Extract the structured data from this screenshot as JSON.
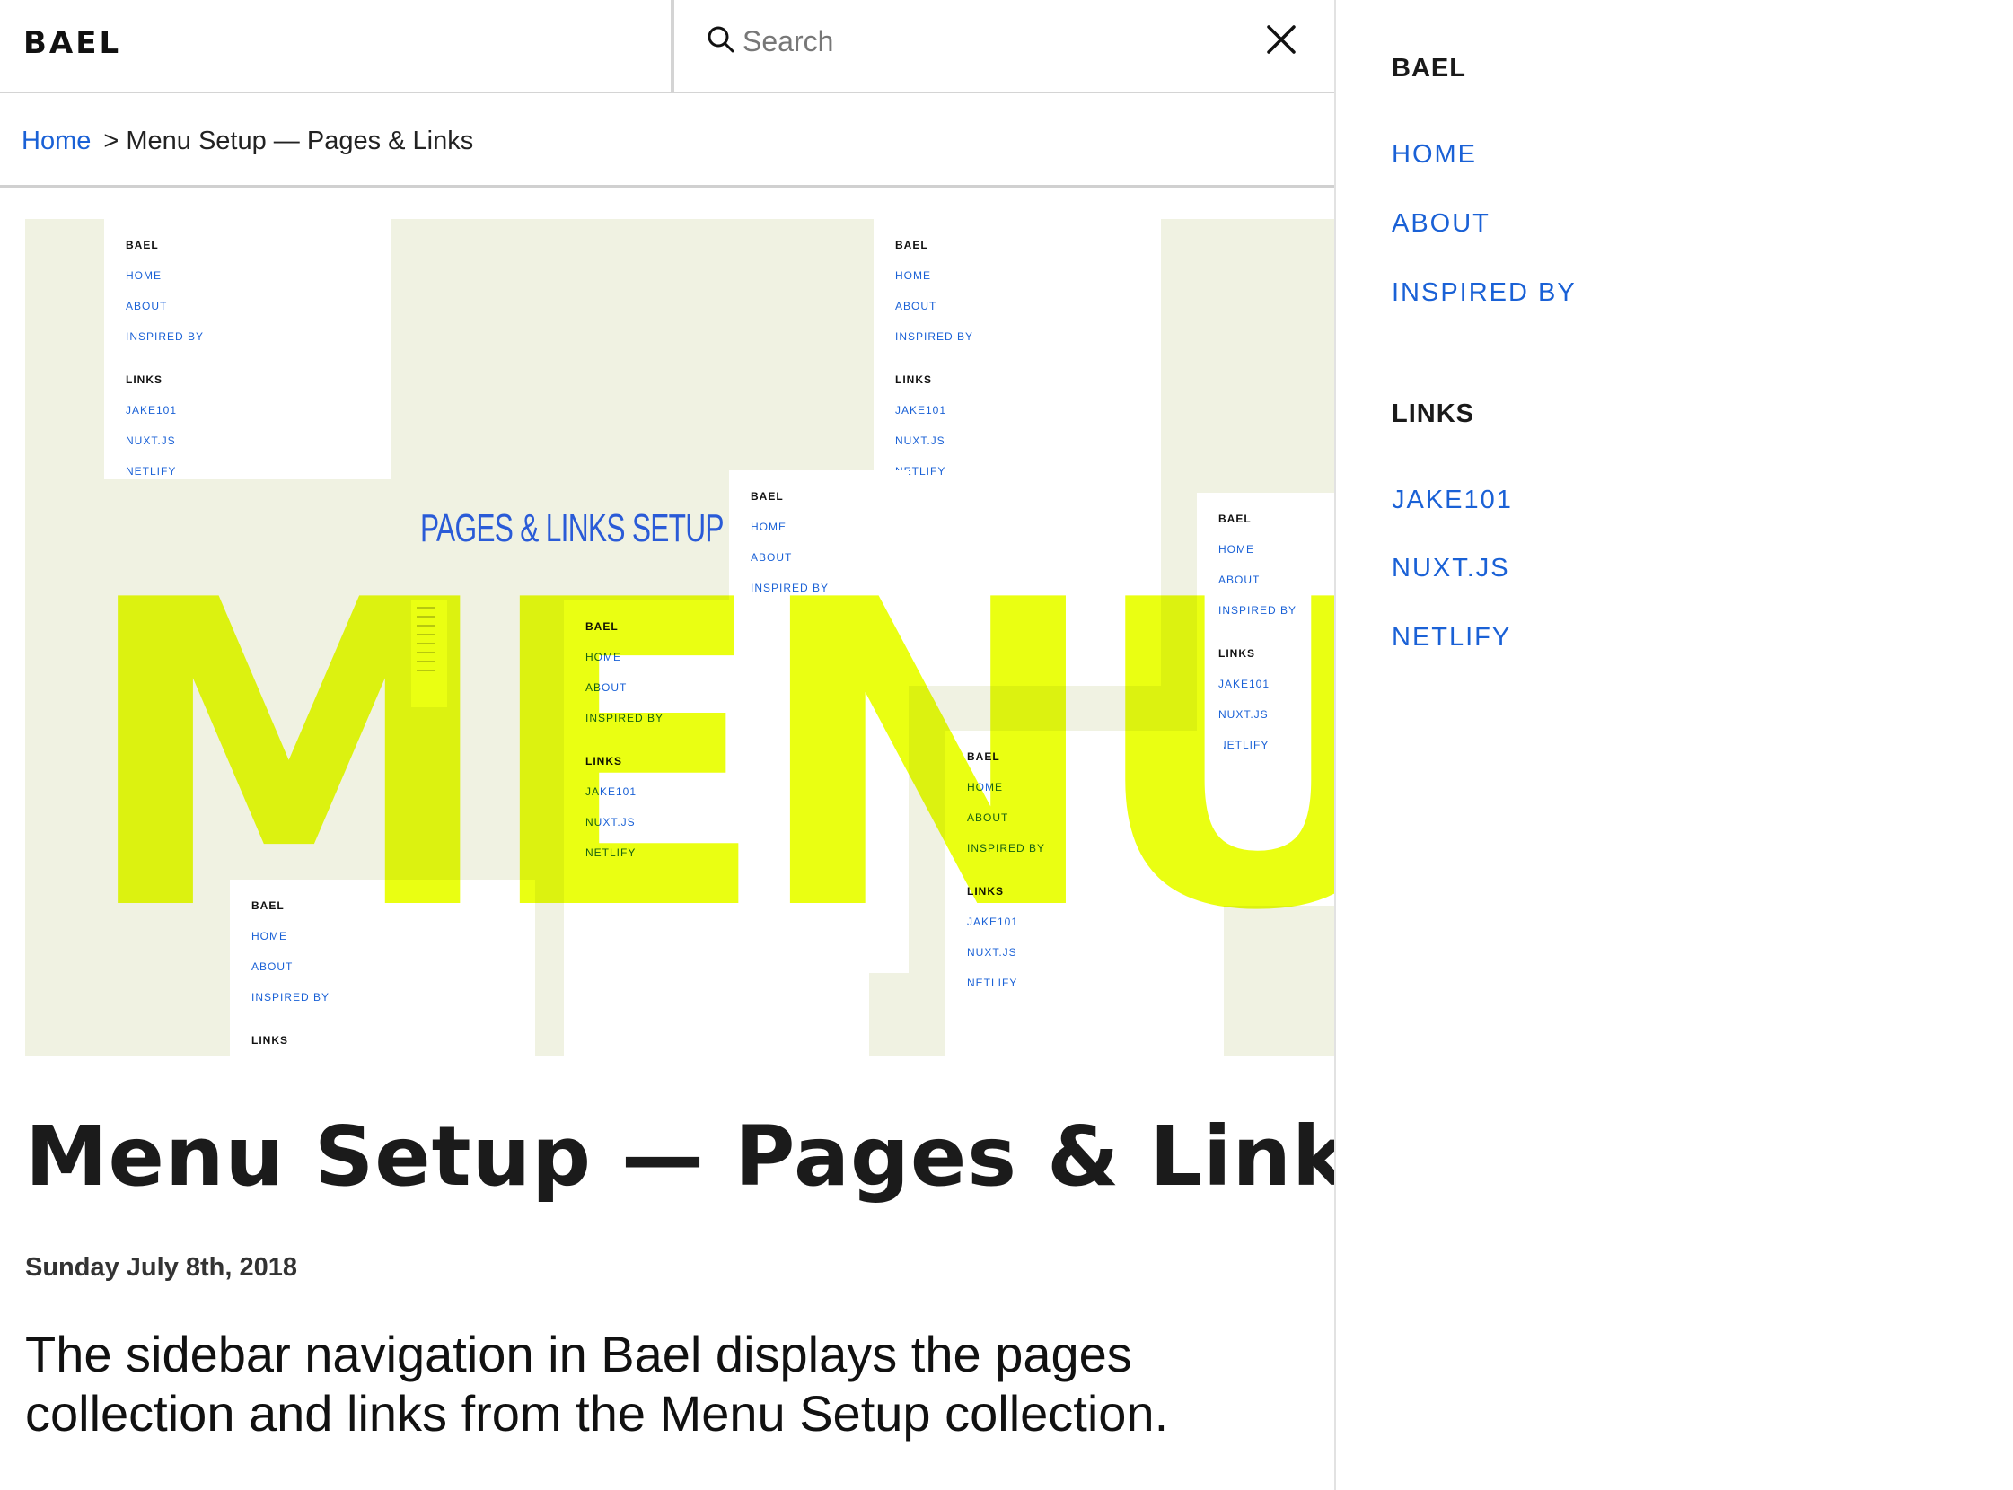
{
  "header": {
    "logo": "BAEL",
    "search_placeholder": "Search"
  },
  "breadcrumb": {
    "home": "Home",
    "current": "> Menu Setup — Pages & Links"
  },
  "hero": {
    "caption": "PAGES & LINKS SETUP",
    "big_text": "MENU",
    "card": {
      "title": "BAEL",
      "links_heading": "LINKS",
      "pages": [
        "HOME",
        "ABOUT",
        "INSPIRED BY"
      ],
      "links": [
        "JAKE101",
        "NUXT.JS",
        "NETLIFY"
      ]
    }
  },
  "article": {
    "title": "Menu Setup — Pages & Links",
    "date": "Sunday July 8th, 2018",
    "body": "The sidebar navigation in Bael displays the pages collection and links from the Menu Setup collection."
  },
  "sidebar": {
    "title": "BAEL",
    "pages": [
      "HOME",
      "ABOUT",
      "INSPIRED BY"
    ],
    "links_heading": "LINKS",
    "links": [
      "JAKE101",
      "NUXT.JS",
      "NETLIFY"
    ]
  },
  "colors": {
    "link": "#1a61d6",
    "highlight": "#e9ff00"
  }
}
